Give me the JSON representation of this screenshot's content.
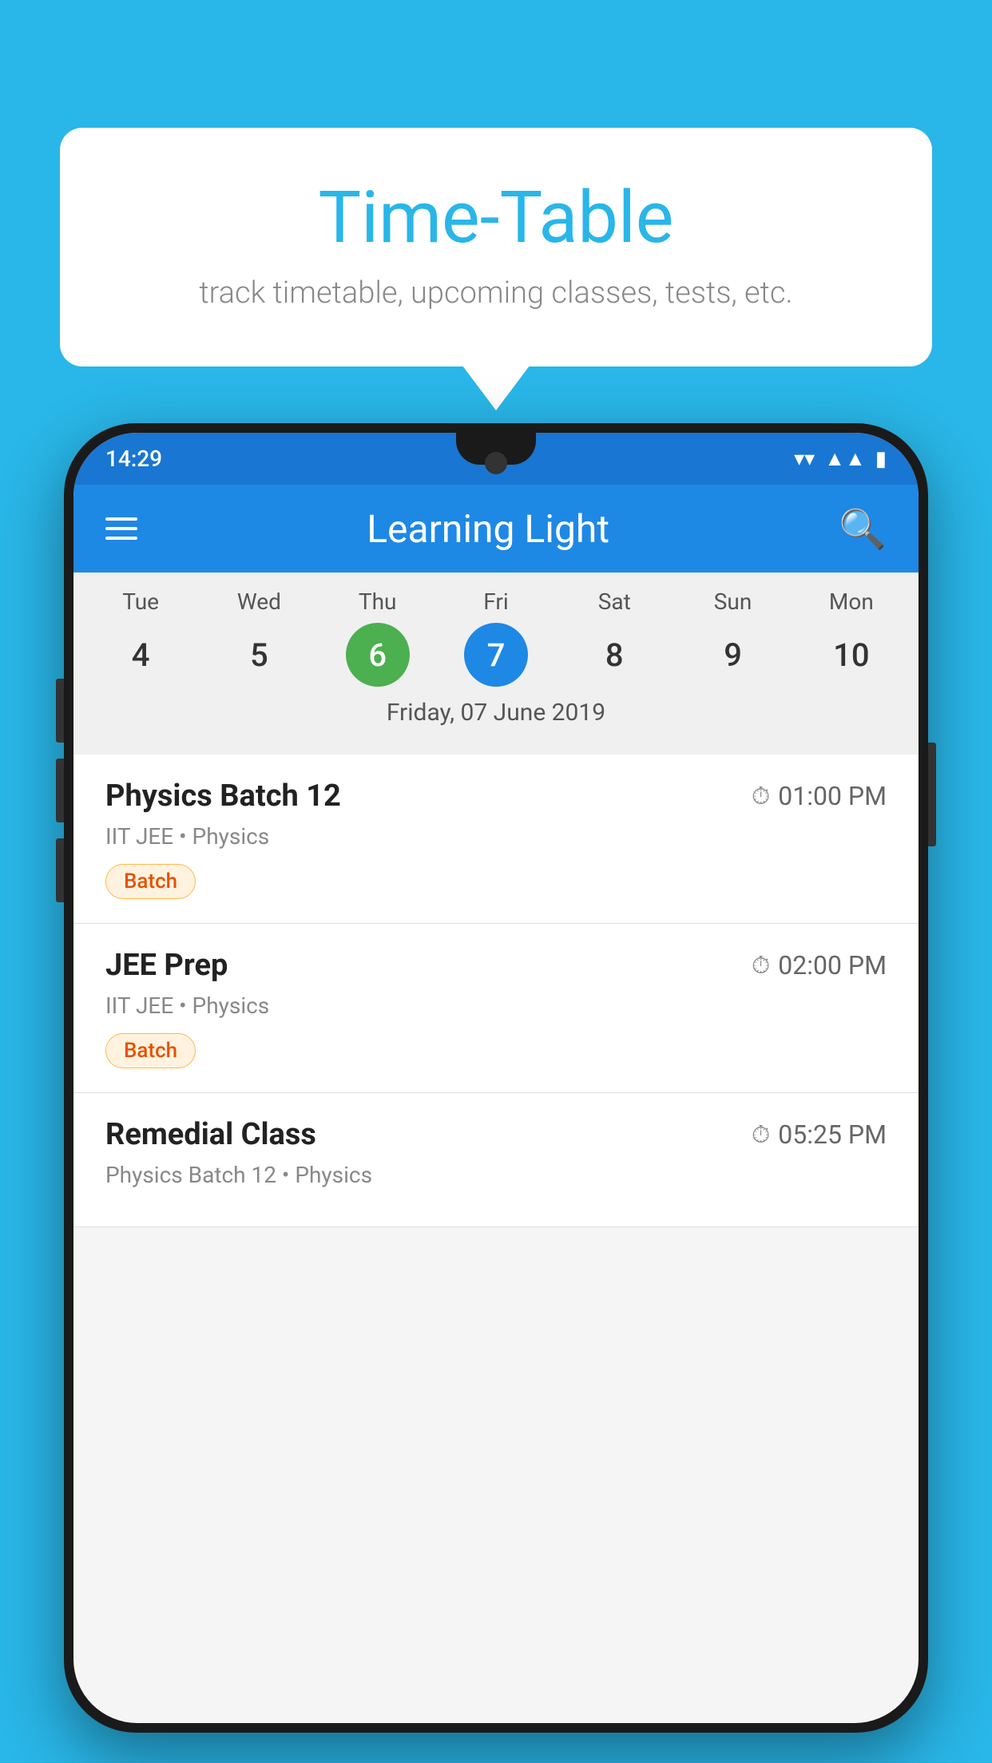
{
  "background_color": "#29B6E8",
  "speech_bubble": {
    "title": "Time-Table",
    "subtitle": "track timetable, upcoming classes, tests, etc."
  },
  "app": {
    "title": "Learning Light",
    "status_time": "14:29"
  },
  "calendar": {
    "days": [
      "Tue",
      "Wed",
      "Thu",
      "Fri",
      "Sat",
      "Sun",
      "Mon"
    ],
    "numbers": [
      "4",
      "5",
      "6",
      "7",
      "8",
      "9",
      "10"
    ],
    "today_index": 2,
    "selected_index": 3,
    "selected_date": "Friday, 07 June 2019"
  },
  "schedule": [
    {
      "title": "Physics Batch 12",
      "time": "01:00 PM",
      "subtitle": "IIT JEE • Physics",
      "badge": "Batch"
    },
    {
      "title": "JEE Prep",
      "time": "02:00 PM",
      "subtitle": "IIT JEE • Physics",
      "badge": "Batch"
    },
    {
      "title": "Remedial Class",
      "time": "05:25 PM",
      "subtitle": "Physics Batch 12 • Physics",
      "badge": ""
    }
  ],
  "labels": {
    "batch_badge": "Batch",
    "search_icon": "🔍",
    "menu_icon": "≡",
    "clock_icon": "🕐"
  }
}
